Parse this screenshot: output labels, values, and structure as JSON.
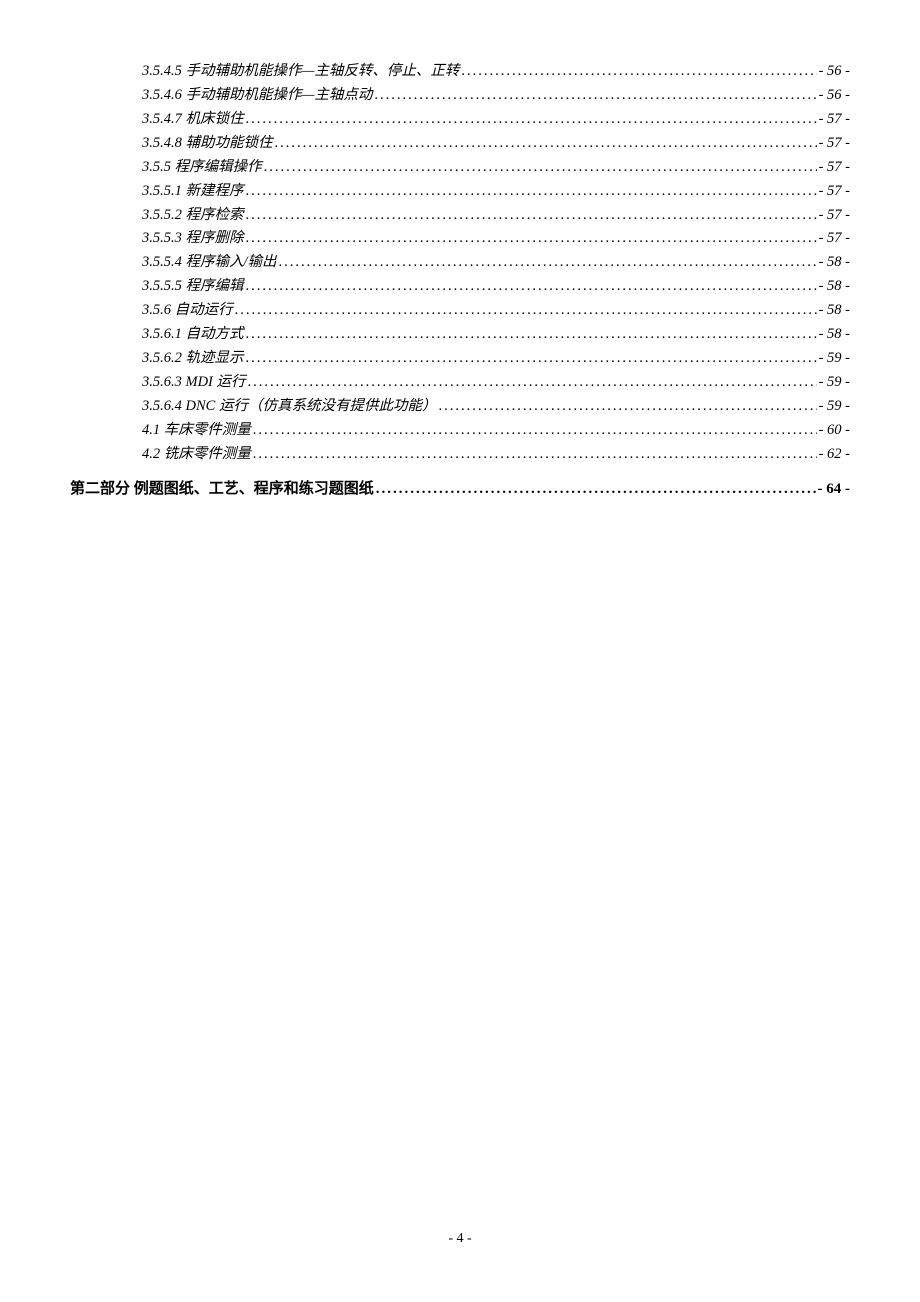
{
  "toc": [
    {
      "level": "level-4",
      "title": "3.5.4.5 手动辅助机能操作—主轴反转、停止、正转",
      "page": "- 56 -"
    },
    {
      "level": "level-4",
      "title": "3.5.4.6 手动辅助机能操作—主轴点动",
      "page": "- 56 -"
    },
    {
      "level": "level-4",
      "title": "3.5.4.7 机床锁住",
      "page": "- 57 -"
    },
    {
      "level": "level-4",
      "title": "3.5.4.8 辅助功能锁住",
      "page": "- 57 -"
    },
    {
      "level": "level-4",
      "title": "3.5.5 程序编辑操作",
      "page": "- 57 -"
    },
    {
      "level": "level-4",
      "title": "3.5.5.1 新建程序",
      "page": "- 57 -"
    },
    {
      "level": "level-4",
      "title": "3.5.5.2 程序检索",
      "page": "- 57 -"
    },
    {
      "level": "level-4",
      "title": "3.5.5.3 程序删除",
      "page": "- 57 -"
    },
    {
      "level": "level-4",
      "title": "3.5.5.4 程序输入/输出",
      "page": "- 58 -"
    },
    {
      "level": "level-4",
      "title": "3.5.5.5 程序编辑",
      "page": "- 58 -"
    },
    {
      "level": "level-4",
      "title": "3.5.6 自动运行",
      "page": "- 58 -"
    },
    {
      "level": "level-4",
      "title": "3.5.6.1 自动方式",
      "page": "- 58 -"
    },
    {
      "level": "level-4",
      "title": "3.5.6.2 轨迹显示",
      "page": "- 59 -"
    },
    {
      "level": "level-4",
      "title": "3.5.6.3 MDI 运行",
      "page": "- 59 -"
    },
    {
      "level": "level-4",
      "title": "3.5.6.4 DNC 运行（仿真系统没有提供此功能）",
      "page": "- 59 -"
    },
    {
      "level": "level-4",
      "title": "4.1 车床零件测量",
      "page": "- 60 -"
    },
    {
      "level": "level-4",
      "title": "4.2 铣床零件测量",
      "page": "- 62 -"
    },
    {
      "level": "level-1",
      "title": "第二部分 例题图纸、工艺、程序和练习题图纸",
      "page": "- 64 -"
    }
  ],
  "pageNumber": "- 4 -"
}
